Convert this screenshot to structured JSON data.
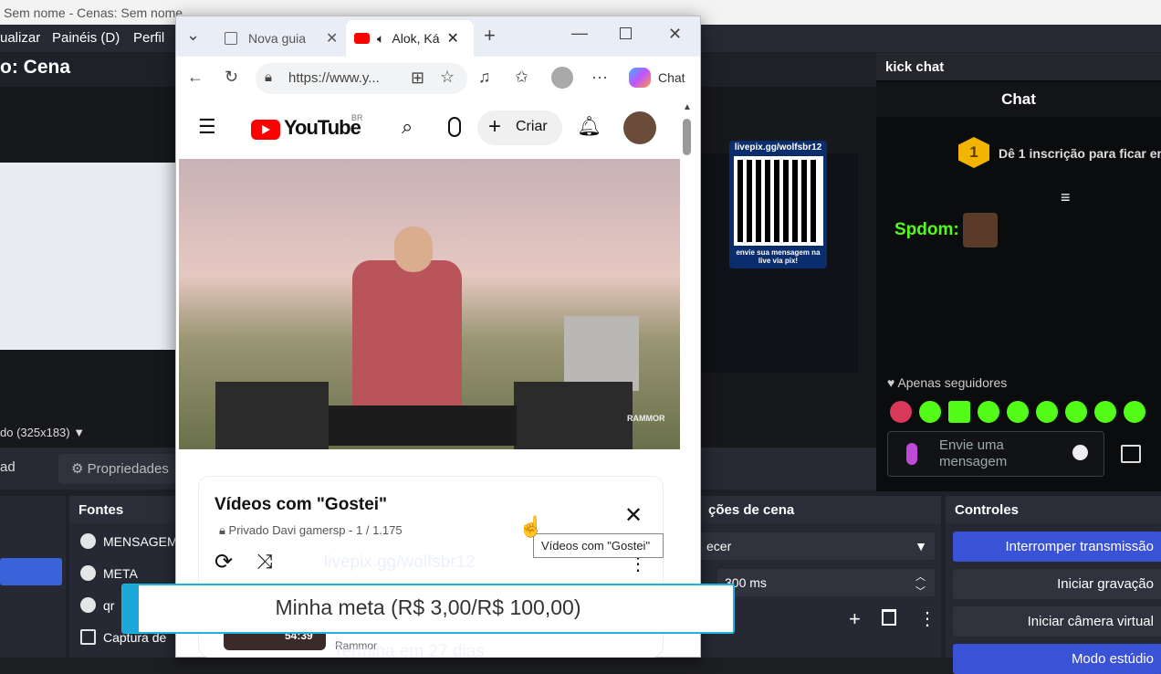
{
  "obs": {
    "window_title": "Sem nome - Cenas: Sem nome",
    "menu": [
      "ualizar",
      "Painéis (D)",
      "Perfil"
    ],
    "scene_title": "o: Cena",
    "resolution_label": "do (325x183)",
    "ad_label": "ad",
    "properties_button": "Propriedades",
    "sources_header": "Fontes",
    "sources": [
      "MENSAGEM",
      "META",
      "qr",
      "Captura de"
    ],
    "transitions_header": "ções de cena",
    "transition_value": "ecer",
    "duration_value": "300 ms",
    "controls_header": "Controles",
    "controls": [
      "Interromper transmissão",
      "Iniciar gravação",
      "Iniciar câmera virtual",
      "Modo estúdio"
    ]
  },
  "kick": {
    "panel_title": "kick chat",
    "chat_title": "Chat",
    "sub_badge": "1",
    "sub_prompt": "Dê 1 inscrição para ficar em",
    "chat_user": "Spdom:",
    "followers_only": "Apenas seguidores",
    "message_placeholder": "Envie uma mensagem"
  },
  "browser": {
    "tabs": [
      {
        "label": "Nova guia"
      },
      {
        "label": "Alok, Ká"
      }
    ],
    "url": "https://www.y...",
    "copilot_label": "Chat"
  },
  "youtube": {
    "logo_text": "YouTube",
    "region": "BR",
    "create_label": "Criar",
    "video_watermark": "RAMMOR",
    "playlist_title": "Vídeos com \"Gostei\"",
    "playlist_privacy": "Privado",
    "playlist_owner": "Davi gamersp - 1 / 1.175",
    "tooltip": "Vídeos com \"Gostei\"",
    "thumb_duration": "54:39",
    "thumb_channel": "Rammor"
  },
  "overlays": {
    "qr_top": "livepix.gg/wolfsbr12",
    "qr_bottom": "envie sua mensagem na live via pix!",
    "livepix_ghost": "livepix.gg/wolfsbr12",
    "goal_text": "Minha meta (R$ 3,00/R$ 100,00)",
    "ends_text": "Termina em 27 dias"
  }
}
